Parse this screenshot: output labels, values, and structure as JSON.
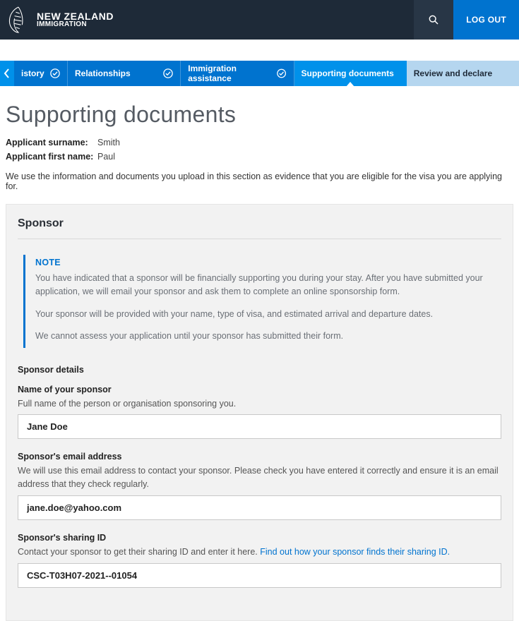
{
  "header": {
    "brand_line1": "NEW ZEALAND",
    "brand_line2": "IMMIGRATION",
    "logout": "LOG OUT"
  },
  "tabs": {
    "history": "istory",
    "relationships": "Relationships",
    "assistance": "Immigration assistance",
    "supporting": "Supporting documents",
    "review": "Review and declare"
  },
  "page": {
    "title": "Supporting documents",
    "surname_label": "Applicant surname:",
    "surname_value": "Smith",
    "firstname_label": "Applicant first name:",
    "firstname_value": "Paul",
    "intro": "We use the information and documents you upload in this section as evidence that you are eligible for the visa you are applying for."
  },
  "sponsor": {
    "heading": "Sponsor",
    "note_title": "NOTE",
    "note_p1": "You have indicated that a sponsor will be financially supporting you during your stay. After you have submitted your application, we will email your sponsor and ask them to complete an online sponsorship form.",
    "note_p2": "Your sponsor will be provided with your name, type of visa, and estimated arrival and departure dates.",
    "note_p3": "We cannot assess your application until your sponsor has submitted their form.",
    "details_label": "Sponsor details",
    "name_label": "Name of your sponsor",
    "name_help": "Full name of the person or organisation sponsoring you.",
    "name_value": "Jane Doe",
    "email_label": "Sponsor's email address",
    "email_help": "We will use this email address to contact your sponsor. Please check you have entered it correctly and ensure it is an email address that they check regularly.",
    "email_value": "jane.doe@yahoo.com",
    "sharing_label": "Sponsor's sharing ID",
    "sharing_help_pre": "Contact your sponsor to get their sharing ID and enter it here. ",
    "sharing_help_link": "Find out how your sponsor finds their sharing ID.",
    "sharing_value": "CSC-T03H07-2021--01054"
  }
}
